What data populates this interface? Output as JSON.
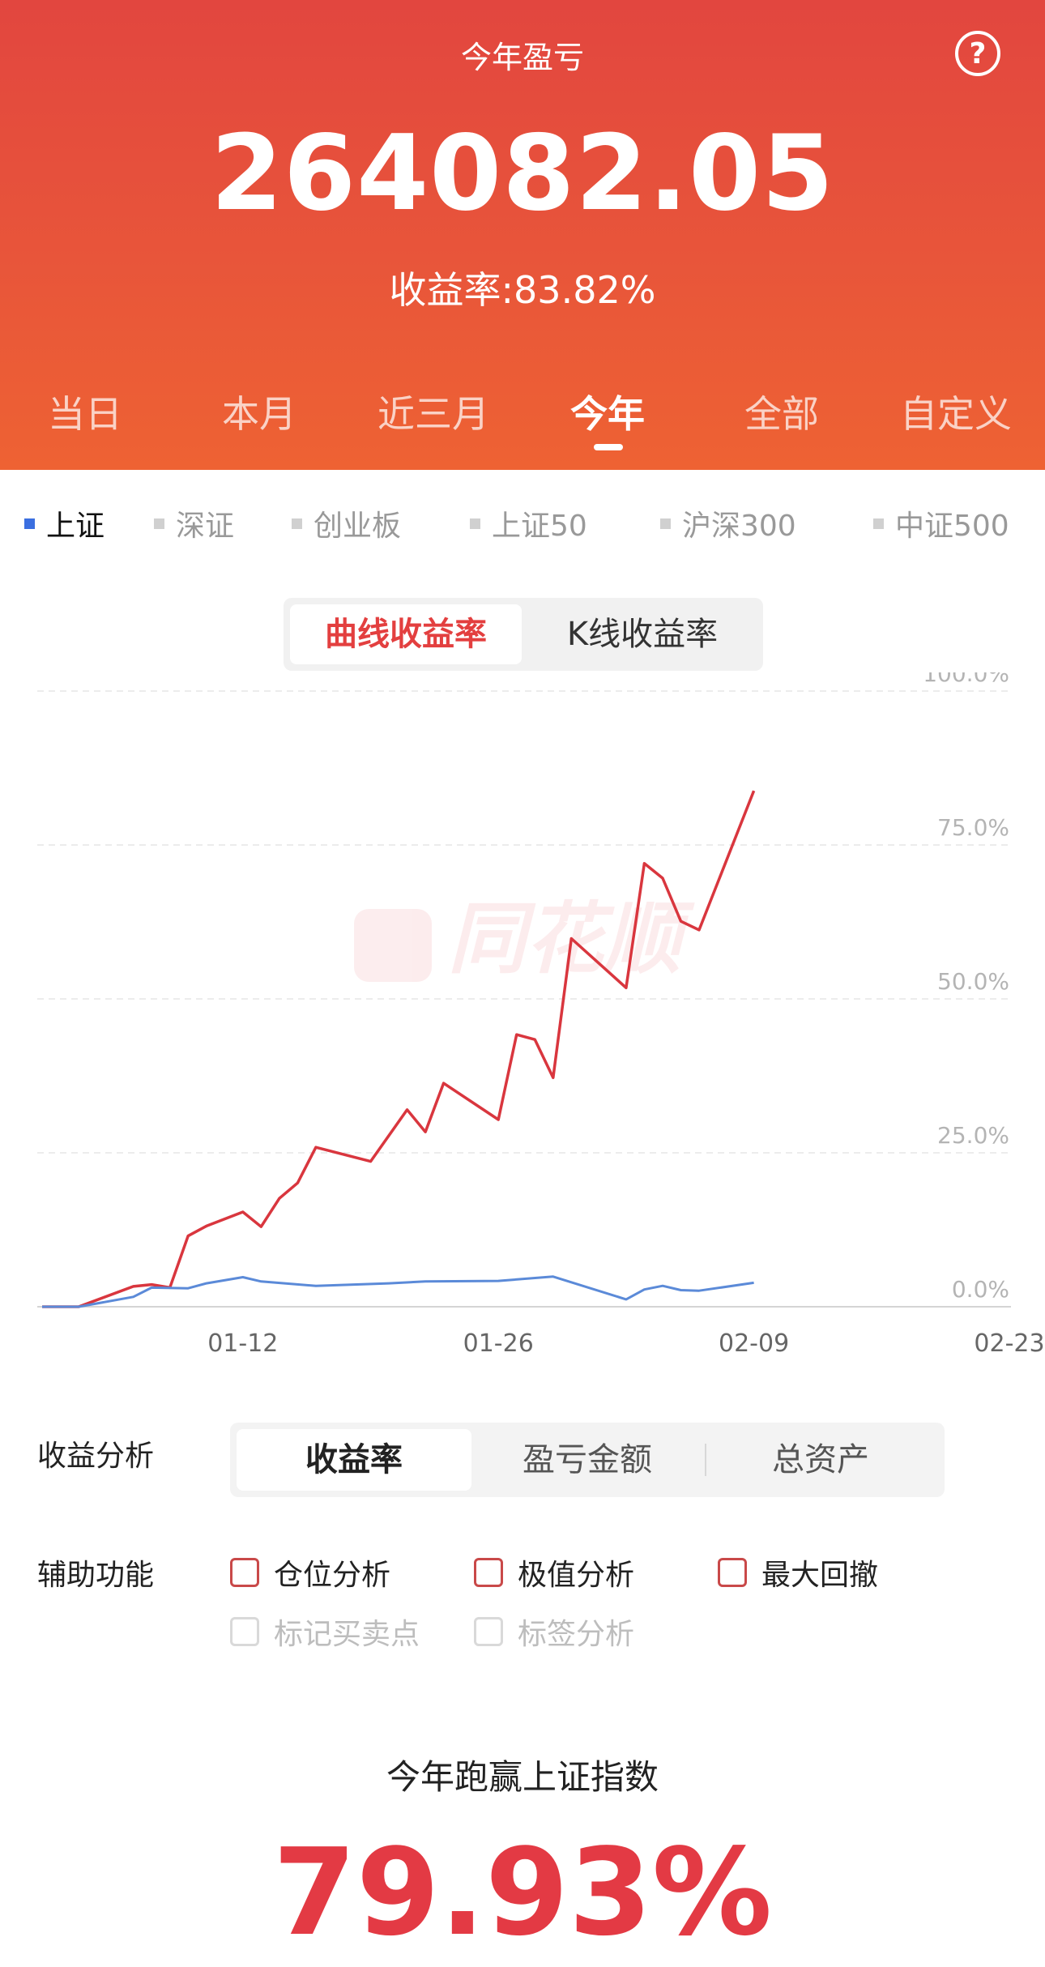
{
  "header": {
    "title": "今年盈亏",
    "help_icon": "question-circle-icon",
    "total_value": "264082.05",
    "yield_label": "收益率:83.82%"
  },
  "period_tabs": [
    {
      "label": "当日",
      "active": false
    },
    {
      "label": "本月",
      "active": false
    },
    {
      "label": "近三月",
      "active": false
    },
    {
      "label": "今年",
      "active": true
    },
    {
      "label": "全部",
      "active": false
    },
    {
      "label": "自定义",
      "active": false
    }
  ],
  "index_selector": [
    {
      "label": "上证",
      "active": true
    },
    {
      "label": "深证",
      "active": false
    },
    {
      "label": "创业板",
      "active": false
    },
    {
      "label": "上证50",
      "active": false
    },
    {
      "label": "沪深300",
      "active": false
    },
    {
      "label": "中证500",
      "active": false
    }
  ],
  "chart_toggle": {
    "curve": "曲线收益率",
    "kline": "K线收益率",
    "active": "curve"
  },
  "colors": {
    "header_top": "#e2463f",
    "header_bottom": "#ee6233",
    "portfolio": "#d9363e",
    "index": "#5b8ad8",
    "accent": "#e33a44"
  },
  "chart_data": {
    "type": "line",
    "xlabel": "",
    "ylabel": "",
    "x_ticks": [
      "01-12",
      "01-26",
      "02-09",
      "02-23"
    ],
    "y_ticks": [
      "100.0%",
      "75.0%",
      "50.0%",
      "25.0%",
      "0.0%"
    ],
    "ylim": [
      0,
      100
    ],
    "x_range": [
      "2021-01-01",
      "2021-02-23"
    ],
    "grid": true,
    "watermark": "同花顺",
    "series": [
      {
        "color": "#d9363e",
        "points": [
          [
            "2021-01-01",
            0
          ],
          [
            "2021-01-03",
            0
          ],
          [
            "2021-01-06",
            3.3
          ],
          [
            "2021-01-07",
            3.6
          ],
          [
            "2021-01-08",
            3.1
          ],
          [
            "2021-01-09",
            11.5
          ],
          [
            "2021-01-10",
            13.1
          ],
          [
            "2021-01-12",
            15.4
          ],
          [
            "2021-01-13",
            13.0
          ],
          [
            "2021-01-14",
            17.6
          ],
          [
            "2021-01-15",
            20.1
          ],
          [
            "2021-01-16",
            25.9
          ],
          [
            "2021-01-19",
            23.6
          ],
          [
            "2021-01-21",
            32.0
          ],
          [
            "2021-01-22",
            28.4
          ],
          [
            "2021-01-23",
            36.3
          ],
          [
            "2021-01-26",
            30.4
          ],
          [
            "2021-01-27",
            44.2
          ],
          [
            "2021-01-28",
            43.4
          ],
          [
            "2021-01-29",
            37.2
          ],
          [
            "2021-01-30",
            59.8
          ],
          [
            "2021-02-02",
            51.8
          ],
          [
            "2021-02-03",
            72.0
          ],
          [
            "2021-02-04",
            69.6
          ],
          [
            "2021-02-05",
            62.6
          ],
          [
            "2021-02-06",
            61.2
          ],
          [
            "2021-02-09",
            83.8
          ]
        ]
      },
      {
        "color": "#5b8ad8",
        "points": [
          [
            "2021-01-01",
            0
          ],
          [
            "2021-01-03",
            0
          ],
          [
            "2021-01-06",
            1.6
          ],
          [
            "2021-01-07",
            3.1
          ],
          [
            "2021-01-09",
            3.0
          ],
          [
            "2021-01-10",
            3.8
          ],
          [
            "2021-01-12",
            4.8
          ],
          [
            "2021-01-13",
            4.1
          ],
          [
            "2021-01-16",
            3.4
          ],
          [
            "2021-01-20",
            3.8
          ],
          [
            "2021-01-22",
            4.1
          ],
          [
            "2021-01-26",
            4.2
          ],
          [
            "2021-01-29",
            4.9
          ],
          [
            "2021-02-02",
            1.2
          ],
          [
            "2021-02-03",
            2.8
          ],
          [
            "2021-02-04",
            3.4
          ],
          [
            "2021-02-05",
            2.7
          ],
          [
            "2021-02-06",
            2.6
          ],
          [
            "2021-02-09",
            3.9
          ]
        ]
      }
    ]
  },
  "analysis": {
    "label": "收益分析",
    "options": [
      {
        "label": "收益率",
        "active": true
      },
      {
        "label": "盈亏金额",
        "active": false
      },
      {
        "label": "总资产",
        "active": false
      }
    ]
  },
  "aux": {
    "label": "辅助功能",
    "options": [
      {
        "label": "仓位分析",
        "enabled": true
      },
      {
        "label": "极值分析",
        "enabled": true
      },
      {
        "label": "最大回撤",
        "enabled": true
      },
      {
        "label": "标记买卖点",
        "enabled": false
      },
      {
        "label": "标签分析",
        "enabled": false
      }
    ]
  },
  "outperform": {
    "title": "今年跑赢上证指数",
    "value": "79.93%"
  }
}
